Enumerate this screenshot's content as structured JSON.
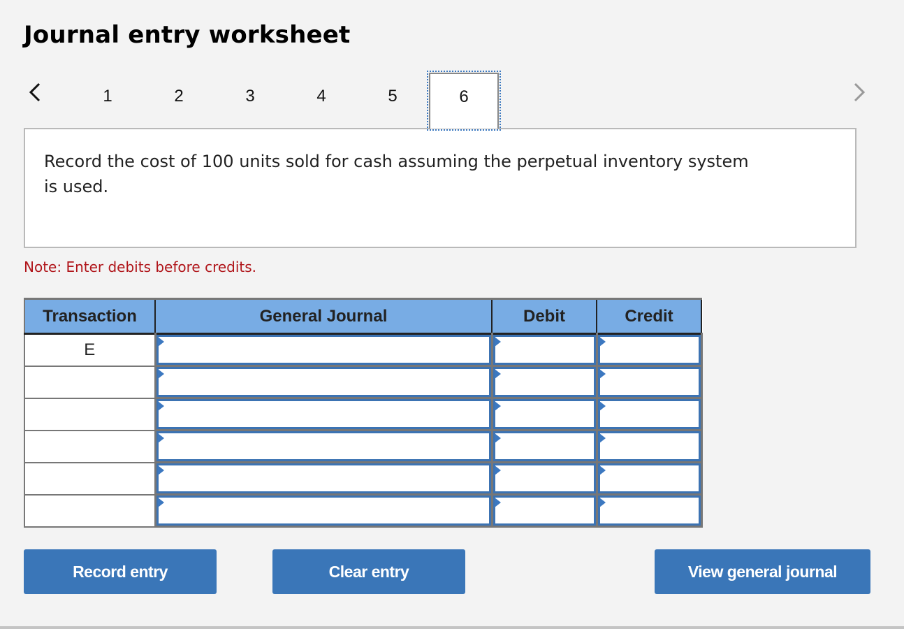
{
  "header": {
    "title": "Journal entry worksheet"
  },
  "pagination": {
    "prev_icon": "chevron-left-icon",
    "next_icon": "chevron-right-icon",
    "pages": [
      "1",
      "2",
      "3",
      "4",
      "5",
      "6"
    ],
    "active_page": "6"
  },
  "prompt": {
    "text": "Record the cost of 100 units sold for cash assuming the perpetual inventory system is used."
  },
  "note": "Note: Enter debits before credits.",
  "table": {
    "headers": [
      "Transaction",
      "General Journal",
      "Debit",
      "Credit"
    ],
    "rows": [
      {
        "transaction": "E",
        "account": "",
        "debit": "",
        "credit": ""
      },
      {
        "transaction": "",
        "account": "",
        "debit": "",
        "credit": ""
      },
      {
        "transaction": "",
        "account": "",
        "debit": "",
        "credit": ""
      },
      {
        "transaction": "",
        "account": "",
        "debit": "",
        "credit": ""
      },
      {
        "transaction": "",
        "account": "",
        "debit": "",
        "credit": ""
      },
      {
        "transaction": "",
        "account": "",
        "debit": "",
        "credit": ""
      }
    ]
  },
  "buttons": {
    "record": "Record entry",
    "clear": "Clear entry",
    "view": "View general journal"
  },
  "colors": {
    "header_bg": "#78ace4",
    "button_bg": "#3a76b8",
    "note_text": "#b0151a",
    "input_border": "#3c73b3"
  }
}
